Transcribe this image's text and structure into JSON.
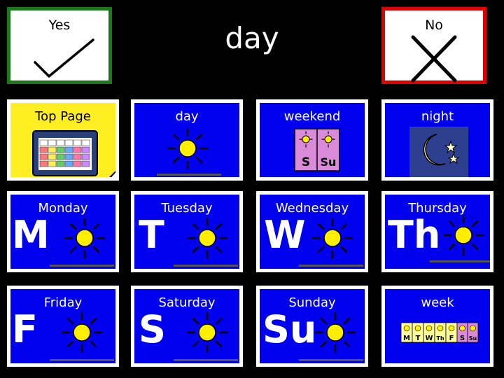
{
  "header": {
    "title": "day",
    "yes_label": "Yes",
    "no_label": "No"
  },
  "tiles": {
    "top_page": "Top Page",
    "day": "day",
    "weekend": "weekend",
    "night": "night",
    "monday": "Monday",
    "tuesday": "Tuesday",
    "wednesday": "Wednesday",
    "thursday": "Thursday",
    "friday": "Friday",
    "saturday": "Saturday",
    "sunday": "Sunday",
    "week": "week"
  },
  "letters": {
    "monday": "M",
    "tuesday": "T",
    "wednesday": "W",
    "thursday": "Th",
    "friday": "F",
    "saturday": "S",
    "sunday": "Su"
  },
  "weekend_icon": {
    "sat": "S",
    "sun": "Su"
  },
  "week_icon": [
    "M",
    "T",
    "W",
    "Th",
    "F",
    "S",
    "Su"
  ],
  "colors": {
    "tile_blue": "#0000ee",
    "yes_border": "#1a7a1a",
    "no_border": "#e00000",
    "top_page_bg": "#ffee22",
    "sun": "#ffee00"
  }
}
